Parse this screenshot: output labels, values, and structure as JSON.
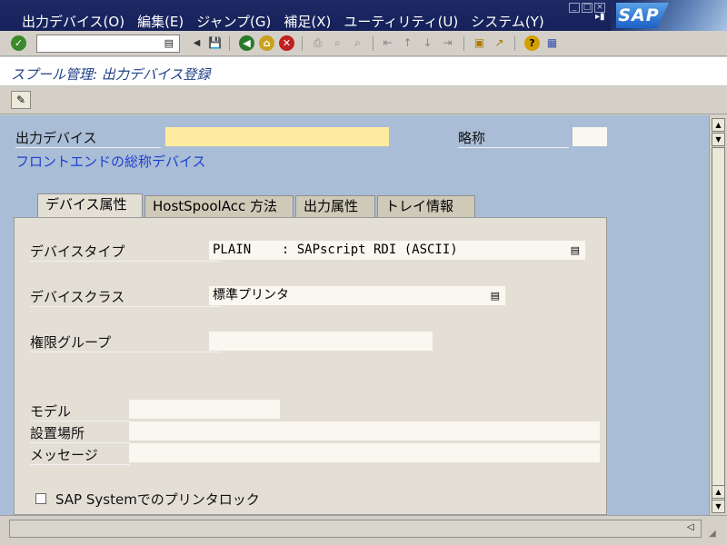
{
  "menubar": {
    "items": [
      "出力デバイス(O)",
      "編集(E)",
      "ジャンプ(G)",
      "補足(X)",
      "ユーティリティ(U)",
      "システム(Y)"
    ],
    "logo_text": "SAP"
  },
  "toolbar": {
    "command_field_value": "",
    "icons": [
      "enter-icon",
      "back-arrow-icon",
      "save-icon",
      "back-icon",
      "exit-icon",
      "cancel-icon",
      "print-icon",
      "find-icon",
      "find-next-icon",
      "first-page-icon",
      "previous-page-icon",
      "next-page-icon",
      "last-page-icon",
      "new-session-icon",
      "shortcut-icon",
      "help-icon",
      "layout-menu-icon"
    ]
  },
  "title": "スプール管理: 出力デバイス登録",
  "header": {
    "output_device_label": "出力デバイス",
    "output_device_value": "",
    "short_name_label": "略称",
    "short_name_value": "",
    "frontend_link": "フロントエンドの総称デバイス"
  },
  "tabs": [
    {
      "label": "デバイス属性",
      "active": true
    },
    {
      "label": "HostSpoolAcc 方法",
      "active": false
    },
    {
      "label": "出力属性",
      "active": false
    },
    {
      "label": "トレイ情報",
      "active": false
    }
  ],
  "device_attributes": {
    "device_type_label": "デバイスタイプ",
    "device_type_value": "PLAIN    : SAPscript RDI (ASCII)",
    "device_class_label": "デバイスクラス",
    "device_class_value": "標準プリンタ",
    "auth_group_label": "権限グループ",
    "auth_group_value": "",
    "model_label": "モデル",
    "model_value": "",
    "location_label": "設置場所",
    "location_value": "",
    "message_label": "メッセージ",
    "message_value": "",
    "lock_checkbox_label": "SAP Systemでのプリンタロック",
    "lock_checked": false
  },
  "status": {
    "text": ""
  }
}
